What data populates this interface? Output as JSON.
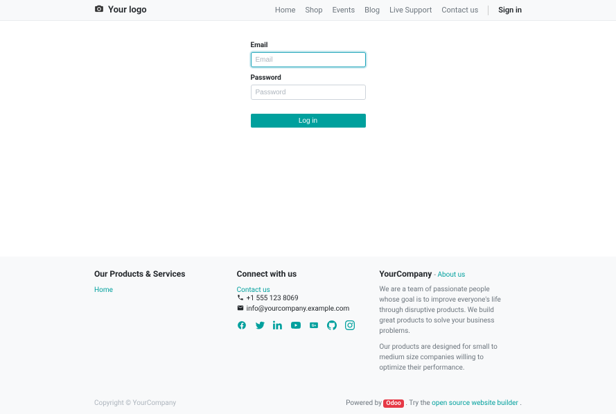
{
  "header": {
    "logo_text": "Your logo",
    "nav": {
      "home": "Home",
      "shop": "Shop",
      "events": "Events",
      "blog": "Blog",
      "live_support": "Live Support",
      "contact_us": "Contact us",
      "sign_in": "Sign in"
    }
  },
  "login": {
    "email_label": "Email",
    "email_placeholder": "Email",
    "password_label": "Password",
    "password_placeholder": "Password",
    "submit": "Log in"
  },
  "footer": {
    "col1": {
      "title": "Our Products & Services",
      "home_link": "Home"
    },
    "col2": {
      "title": "Connect with us",
      "contact_link": "Contact us",
      "phone": "+1 555 123 8069",
      "email": "info@yourcompany.example.com"
    },
    "col3": {
      "company": "YourCompany",
      "about_prefix": " - ",
      "about_link": "About us",
      "desc1": "We are a team of passionate people whose goal is to improve everyone's life through disruptive products. We build great products to solve your business problems.",
      "desc2": "Our products are designed for small to medium size companies willing to optimize their performance."
    },
    "bottom": {
      "copyright": "Copyright © YourCompany",
      "powered_prefix": "Powered by ",
      "odoo": "Odoo",
      "try_prefix": ". Try the ",
      "builder_link": "open source website builder",
      "suffix": "."
    }
  }
}
